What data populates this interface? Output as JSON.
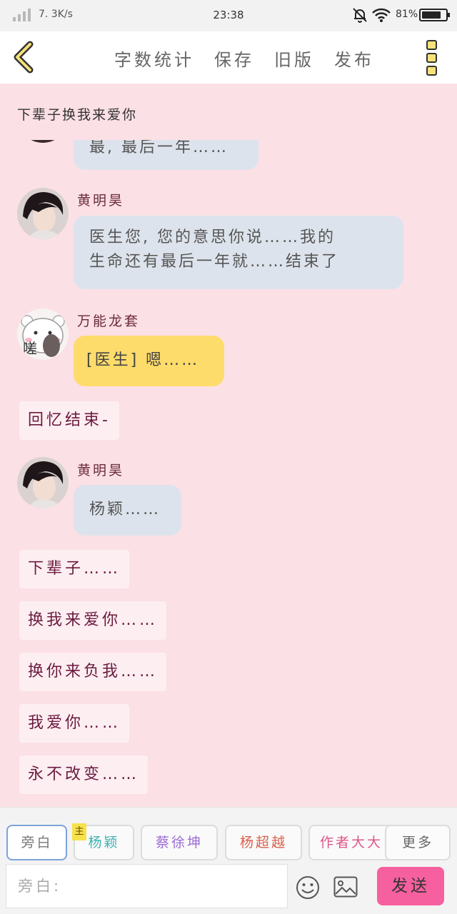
{
  "status": {
    "net_speed": "7. 3K/s",
    "time": "23:38",
    "battery": "81%",
    "battery_level": 0.81
  },
  "toolbar": {
    "actions": [
      "字数统计",
      "保存",
      "旧版",
      "发布"
    ]
  },
  "chapter_title": "下辈子换我来爱你",
  "messages": [
    {
      "type": "bubble",
      "style": "grey",
      "text": "最, 最后一年……"
    },
    {
      "type": "bubble",
      "style": "grey",
      "speaker": "黄明昊",
      "lines": [
        "医生您, 您的意思你说……我的",
        "生命还有最后一年就……结束了"
      ]
    },
    {
      "type": "bubble",
      "style": "yellow",
      "speaker": "万能龙套",
      "text": "[医生] 嗯……",
      "avatar_text": "嗟"
    },
    {
      "type": "narration",
      "text": "回忆结束-"
    },
    {
      "type": "bubble",
      "style": "grey",
      "speaker": "黄明昊",
      "text": "杨颖……"
    },
    {
      "type": "narration",
      "text": "下辈子……"
    },
    {
      "type": "narration",
      "text": "换我来爱你……"
    },
    {
      "type": "narration",
      "text": "换你来负我……"
    },
    {
      "type": "narration",
      "text": "我爱你……"
    },
    {
      "type": "narration",
      "text": "永不改变……"
    }
  ],
  "roles": [
    {
      "label": "旁白",
      "color": "#777777",
      "active": true
    },
    {
      "label": "杨颖",
      "color": "#3fb3b0",
      "badge": "主"
    },
    {
      "label": "蔡徐坤",
      "color": "#9d6bd6"
    },
    {
      "label": "杨超越",
      "color": "#d9604c"
    },
    {
      "label": "作者大大",
      "color": "#e0568c"
    },
    {
      "label": "更多",
      "color": "#666666"
    }
  ],
  "input": {
    "placeholder": "旁白:"
  },
  "send_label": "发送",
  "icons": [
    "back-arrow-icon",
    "more-icon",
    "emoji-icon",
    "image-icon",
    "bell-off-icon",
    "wifi-icon",
    "battery-icon",
    "signal-icon"
  ]
}
